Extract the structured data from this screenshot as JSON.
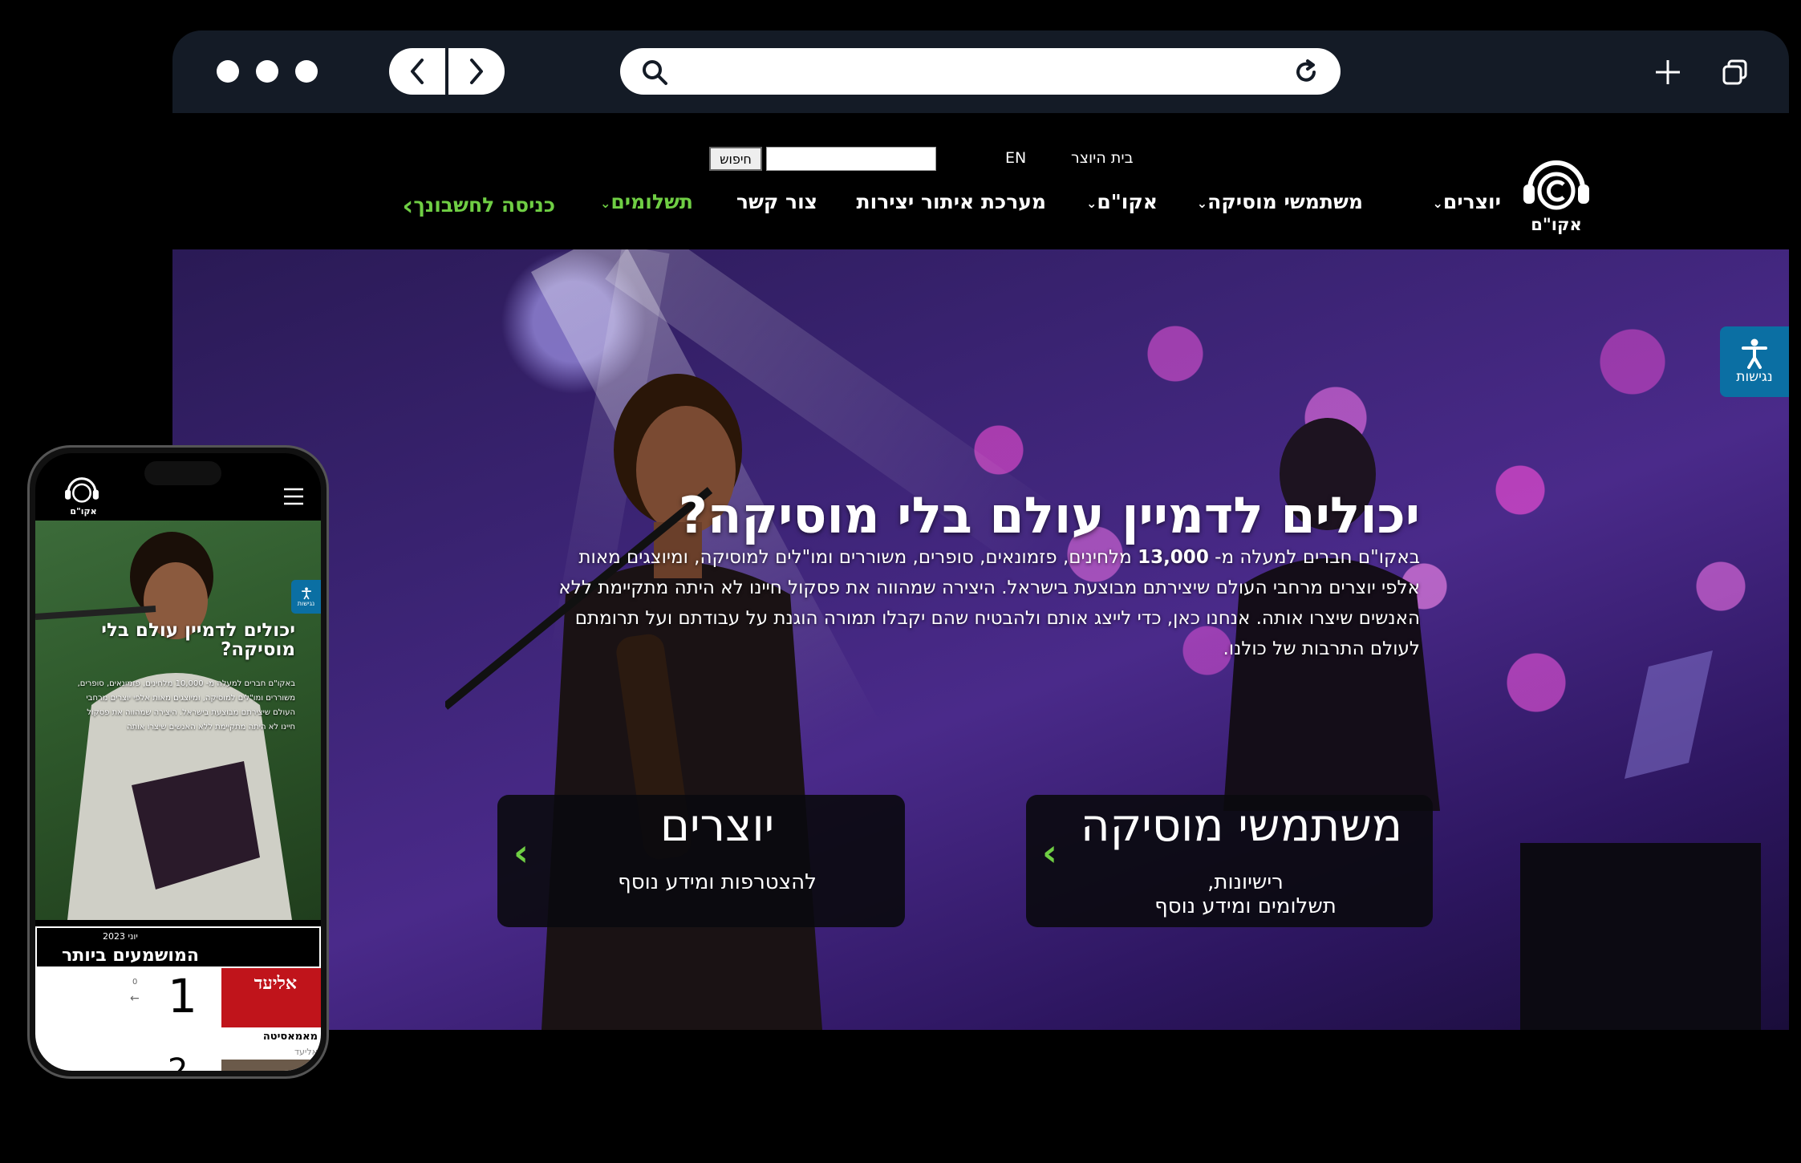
{
  "browser": {
    "window_dots": [
      "dot",
      "dot",
      "dot"
    ],
    "back_icon": "chevron-left-icon",
    "forward_icon": "chevron-right-icon",
    "url": "",
    "search_icon": "search-icon",
    "reload_icon": "reload-icon",
    "new_tab_icon": "plus-icon",
    "tabs_icon": "tabs-icon"
  },
  "site": {
    "utility": {
      "home_link": "בית היוצר",
      "lang_link": "EN",
      "search_button": "חיפוש",
      "search_value": ""
    },
    "logo_text": "אקו\"ם",
    "nav": [
      {
        "label": "יוצרים",
        "has_caret": true
      },
      {
        "label": "משתמשי מוסיקה",
        "has_caret": true
      },
      {
        "label": "אקו\"ם",
        "has_caret": true
      },
      {
        "label": "מערכת איתור יצירות",
        "has_caret": false
      },
      {
        "label": "צור קשר",
        "has_caret": false
      },
      {
        "label": "תשלומים",
        "has_caret": true
      },
      {
        "label": "כניסה לחשבונך",
        "has_caret": false
      }
    ],
    "hero": {
      "title": "יכולים לדמיין עולם בלי מוסיקה?",
      "text_prefix": "באקו\"ם חברים למעלה מ- ",
      "text_number": "13,000",
      "text_rest": " מלחינים, פזמונאים, סופרים, משוררים ומו\"לים למוסיקה, ומיוצגים מאות אלפי יוצרים מרחבי העולם שיצירתם מבוצעת בישראל. היצירה שמהווה את פסקול חיינו לא היתה מתקיימת ללא האנשים שיצרו אותה. אנחנו כאן, כדי לייצג אותם ולהבטיח שהם יקבלו תמורה הוגנת על עבודתם ועל תרומתם לעולם התרבות של כולנו.",
      "cards": [
        {
          "title": "משתמשי מוסיקה",
          "sub1": "רישיונות,",
          "sub2": "תשלומים ומידע נוסף"
        },
        {
          "title": "יוצרים",
          "sub1": "להצטרפות ומידע נוסף",
          "sub2": ""
        }
      ]
    },
    "accessibility_label": "נגישות"
  },
  "phone": {
    "logo_text": "אקו\"ם",
    "hero_title": "יכולים לדמיין עולם בלי מוסיקה?",
    "hero_text": "באקו\"ם חברים למעלה מ- 10,000 מלחינים, פזמונאים, סופרים, משוררים ומו\"לים למוסיקה, ומיוצגים מאות אלפי יוצרים מרחבי העולם שיצירתם מבוצעת בישראל. היצירה שמהווה את פסקול חיינו לא היתה מתקיימת ללא האנשים שיצרו אותה",
    "accessibility_label": "נגישות",
    "chart_month": "יוני 2023",
    "chart_title": "המושמעים ביותר",
    "chart_rank": "1",
    "chart_change": "0",
    "chart_song": "מאמאסיטה",
    "chart_artist": "אליעד",
    "chart_next_rank": "2"
  },
  "colors": {
    "accent_green": "#6fce44",
    "chrome": "#141b26",
    "access_blue": "#0b6fa3"
  }
}
